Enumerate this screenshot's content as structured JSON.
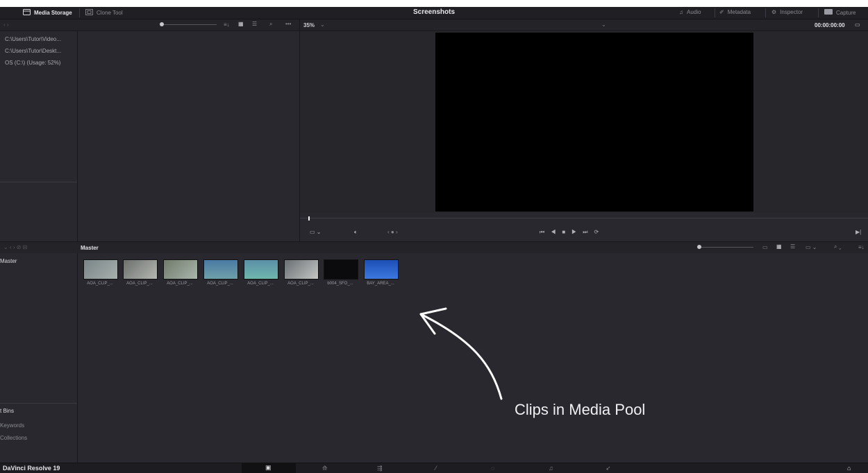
{
  "topbar": {
    "media_storage": "Media Storage",
    "clone_tool": "Clone Tool",
    "title": "Screenshots",
    "audio": "Audio",
    "metadata": "Metadata",
    "inspector": "Inspector",
    "capture": "Capture"
  },
  "toolbar": {
    "zoom": "35%",
    "timecode": "00:00:00:00"
  },
  "storage": {
    "locations": [
      "C:\\Users\\Tutor\\Video...",
      "C:\\Users\\Tutor\\Deskt...",
      "OS (C:\\) (Usage: 52%)"
    ]
  },
  "pool": {
    "header": "Master",
    "bin_master": "Master",
    "smart_bins": "t Bins",
    "keywords": "Keywords",
    "collections": "Collections",
    "clips": [
      {
        "label": "AOA_CLIP_...",
        "c1": "#7a8588",
        "c2": "#a7b0ad"
      },
      {
        "label": "AOA_CLIP_...",
        "c1": "#6c706c",
        "c2": "#b4b7b2"
      },
      {
        "label": "AOA_CLIP_...",
        "c1": "#6f7a6a",
        "c2": "#aab6ad"
      },
      {
        "label": "AOA_CLIP_...",
        "c1": "#4a7aa3",
        "c2": "#6ea0a8"
      },
      {
        "label": "AOA_CLIP_...",
        "c1": "#5b8fa6",
        "c2": "#6fb7ad"
      },
      {
        "label": "AOA_CLIP_...",
        "c1": "#6a6f73",
        "c2": "#c4c7c5"
      },
      {
        "label": "b004_SFO_...",
        "c1": "#0b0b0d",
        "c2": "#1c1c20"
      },
      {
        "label": "BAY_AREA_...",
        "c1": "#1d4fb5",
        "c2": "#3b78e0"
      }
    ]
  },
  "annotation": {
    "text": "Clips in Media Pool"
  },
  "footer": {
    "app_name": "DaVinci Resolve 19"
  },
  "colors": {
    "bg": "#28282e",
    "topbar": "#1f1f24",
    "accent": "#e6e6ea"
  }
}
